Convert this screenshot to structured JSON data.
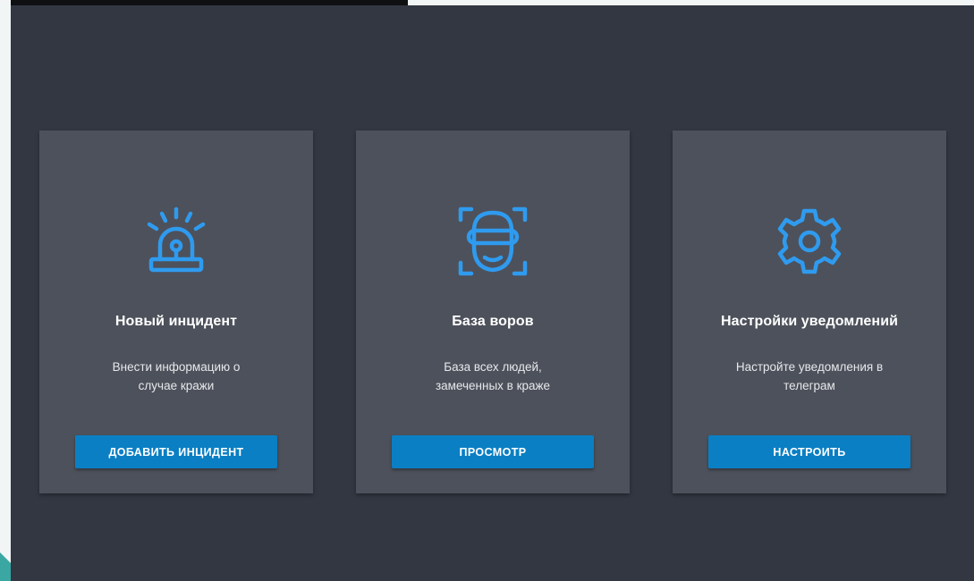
{
  "colors": {
    "app_background": "#323742",
    "card_background": "#4d515b",
    "icon_accent": "#2f9bef",
    "button_background": "#0a7fc4",
    "text_primary": "#ffffff"
  },
  "cards": [
    {
      "icon": "siren-alarm-icon",
      "title": "Новый инцидент",
      "description_line1": "Внести информацию о",
      "description_line2": "случае кражи",
      "button_label": "ДОБАВИТЬ ИНЦИДЕНТ"
    },
    {
      "icon": "face-recognition-icon",
      "title": "База воров",
      "description_line1": "База всех людей,",
      "description_line2": "замеченных в краже",
      "button_label": "ПРОСМОТР"
    },
    {
      "icon": "gear-icon",
      "title": "Настройки уведомлений",
      "description_line1": "Настройте уведомления в",
      "description_line2": "телеграм",
      "button_label": "НАСТРОИТЬ"
    }
  ]
}
